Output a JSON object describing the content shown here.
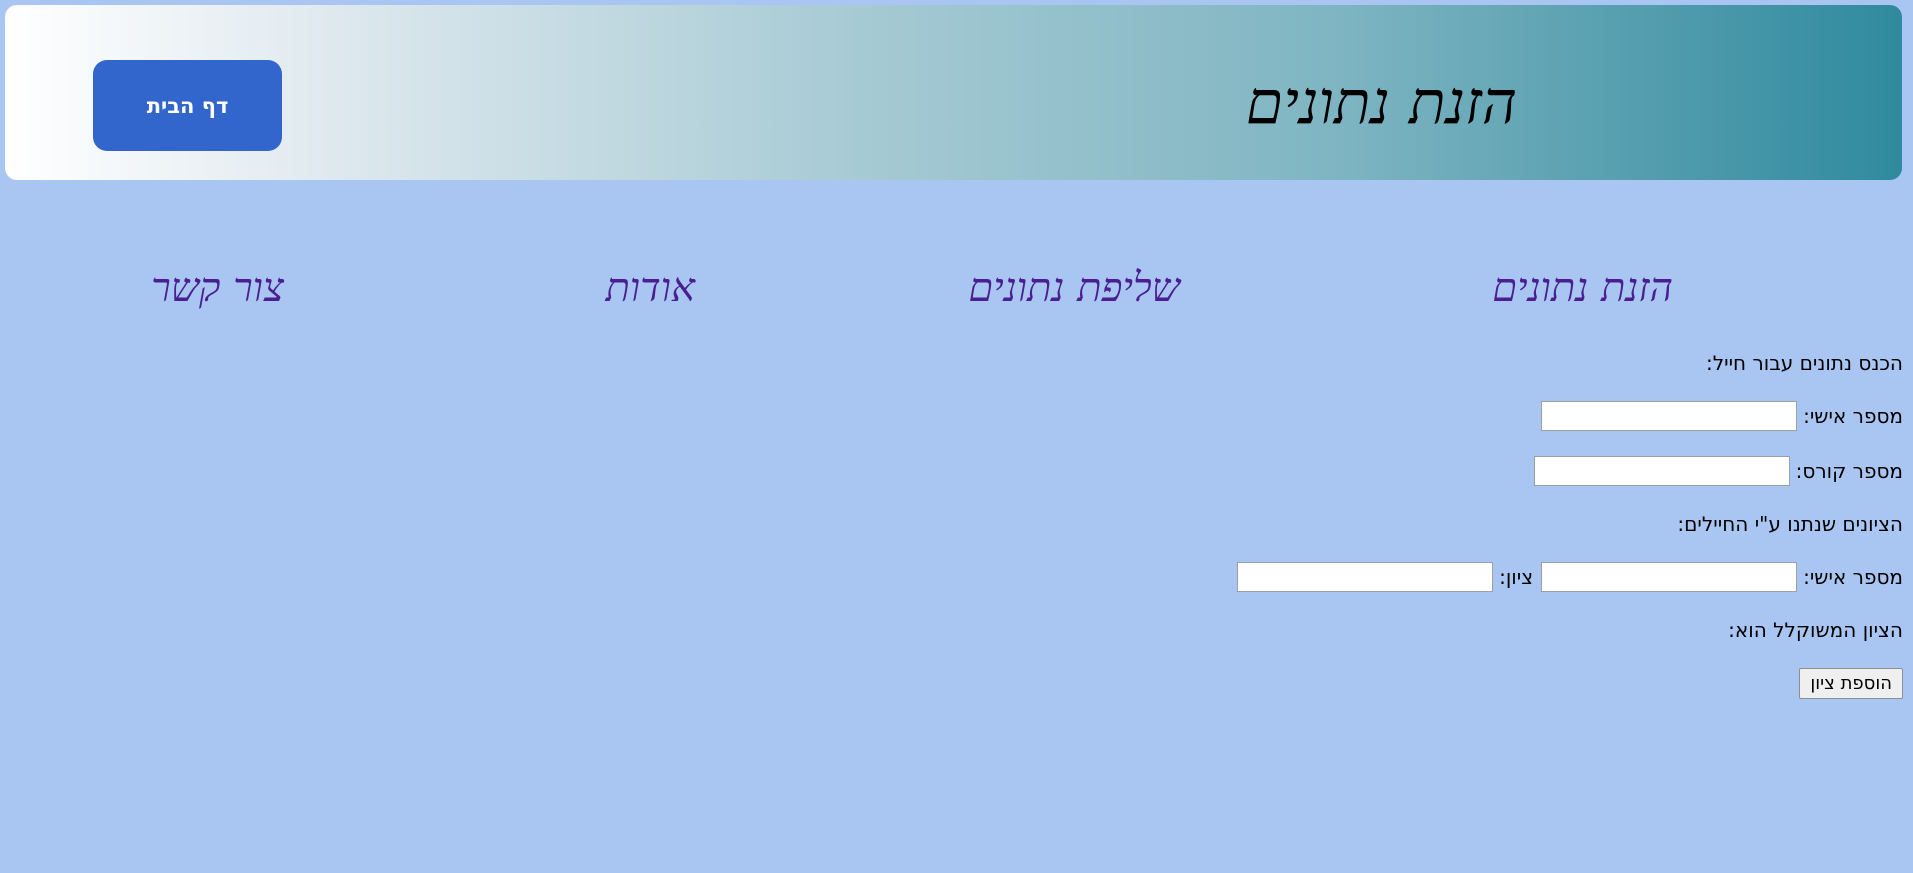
{
  "header": {
    "title": "הזנת נתונים",
    "home_button_label": "דף הבית"
  },
  "nav": {
    "items": [
      {
        "label": "הזנת נתונים"
      },
      {
        "label": "שליפת נתונים"
      },
      {
        "label": "אודות"
      },
      {
        "label": "צור קשר"
      }
    ]
  },
  "form": {
    "intro_label": "הכנס נתונים עבור חייל:",
    "personal_number_label": "מספר אישי:",
    "personal_number_value": "",
    "course_number_label": "מספר קורס:",
    "course_number_value": "",
    "grades_section_label": "הציונים שנתנו ע\"י החיילים:",
    "grade_personal_number_label": "מספר אישי:",
    "grade_personal_number_value": "",
    "grade_label": "ציון:",
    "grade_value": "",
    "weighted_grade_label": "הציון המשוקלל הוא:",
    "add_grade_button_label": "הוספת ציון"
  },
  "colors": {
    "background": "#a9c5f1",
    "home_button": "#3366cc",
    "nav_link": "#4a1f91",
    "header_gradient_end": "#2f8a9e"
  }
}
